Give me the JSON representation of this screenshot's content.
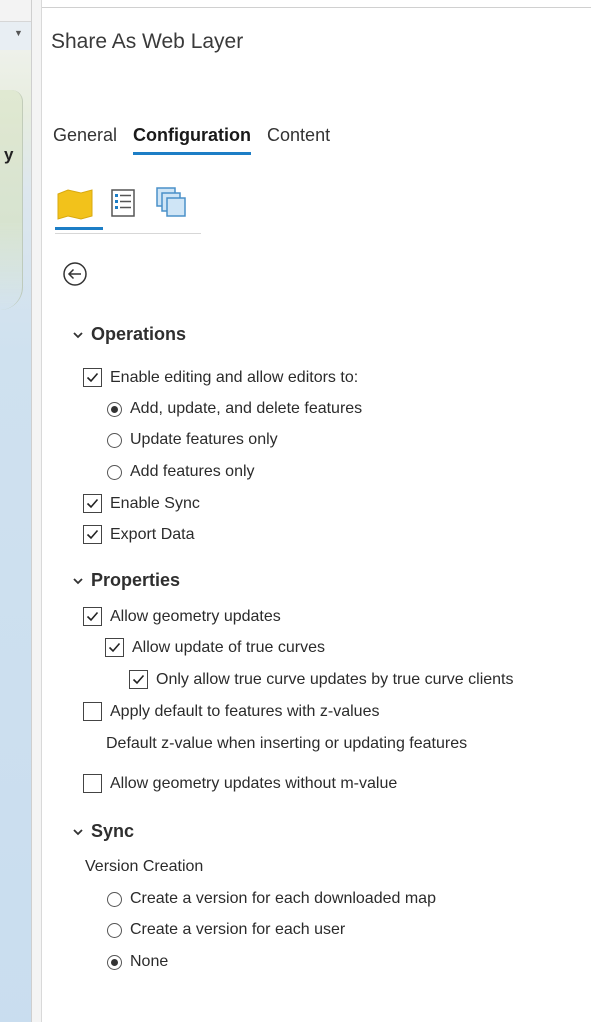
{
  "pane": {
    "title": "Share As Web Layer"
  },
  "map": {
    "label_fragment": "y"
  },
  "tabs": [
    {
      "label": "General"
    },
    {
      "label": "Configuration"
    },
    {
      "label": "Content"
    }
  ],
  "icon_tabs": [
    "layers-map-icon",
    "properties-list-icon",
    "stacked-pages-icon"
  ],
  "operations": {
    "header": "Operations",
    "enable_editing": {
      "label": "Enable editing and allow editors to:",
      "checked": true
    },
    "edit_options": [
      {
        "label": "Add, update, and delete features",
        "selected": true
      },
      {
        "label": "Update features only",
        "selected": false
      },
      {
        "label": "Add features only",
        "selected": false
      }
    ],
    "enable_sync": {
      "label": "Enable Sync",
      "checked": true
    },
    "export_data": {
      "label": "Export Data",
      "checked": true
    }
  },
  "properties": {
    "header": "Properties",
    "allow_geometry_updates": {
      "label": "Allow geometry updates",
      "checked": true
    },
    "allow_true_curves": {
      "label": "Allow update of true curves",
      "checked": true
    },
    "only_true_curve_clients": {
      "label": "Only allow true curve updates by true curve clients",
      "checked": true
    },
    "apply_default_z": {
      "label": "Apply default to features with z-values",
      "checked": false
    },
    "default_z_label": "Default z-value when inserting or updating features",
    "allow_without_m": {
      "label": "Allow geometry updates without m-value",
      "checked": false
    }
  },
  "sync": {
    "header": "Sync",
    "version_creation_label": "Version Creation",
    "options": [
      {
        "label": "Create a version for each downloaded map",
        "selected": false
      },
      {
        "label": "Create a version for each user",
        "selected": false
      },
      {
        "label": "None",
        "selected": true
      }
    ]
  },
  "colors": {
    "accent": "#1d7ec6",
    "map_icon": "#f2c21b"
  }
}
